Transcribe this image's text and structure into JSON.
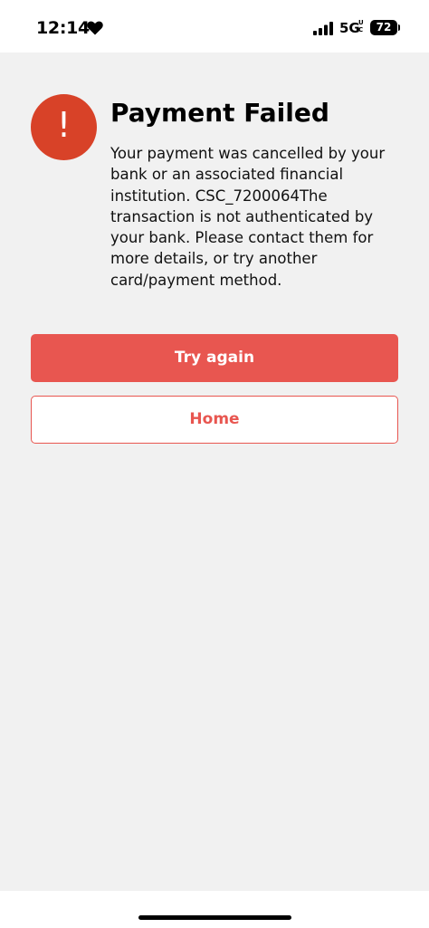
{
  "status_bar": {
    "time": "12:14",
    "network": "5G",
    "network_sup": "UC",
    "battery": "72"
  },
  "alert": {
    "icon": "exclamation-icon",
    "mark": "!",
    "title": "Payment Failed",
    "message": "Your payment was cancelled by your bank or an associated financial institution. CSC_7200064The transaction is not authenticated by your bank. Please contact them for more details, or try another card/payment method."
  },
  "actions": {
    "try_again_label": "Try again",
    "home_label": "Home"
  },
  "colors": {
    "accent": "#e85650",
    "alert_icon": "#d84228",
    "background": "#f1f1f1"
  }
}
